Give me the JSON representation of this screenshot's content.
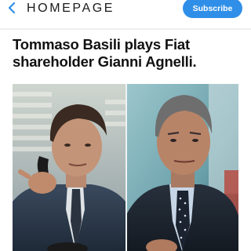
{
  "header": {
    "title": "HOMEPAGE",
    "subscribe_label": "Subscribe",
    "back_icon": "chevron-left-icon",
    "accent_color": "#2f8fe8"
  },
  "article": {
    "headline": "Tommaso Basili plays Fiat shareholder Gianni Agnelli."
  }
}
